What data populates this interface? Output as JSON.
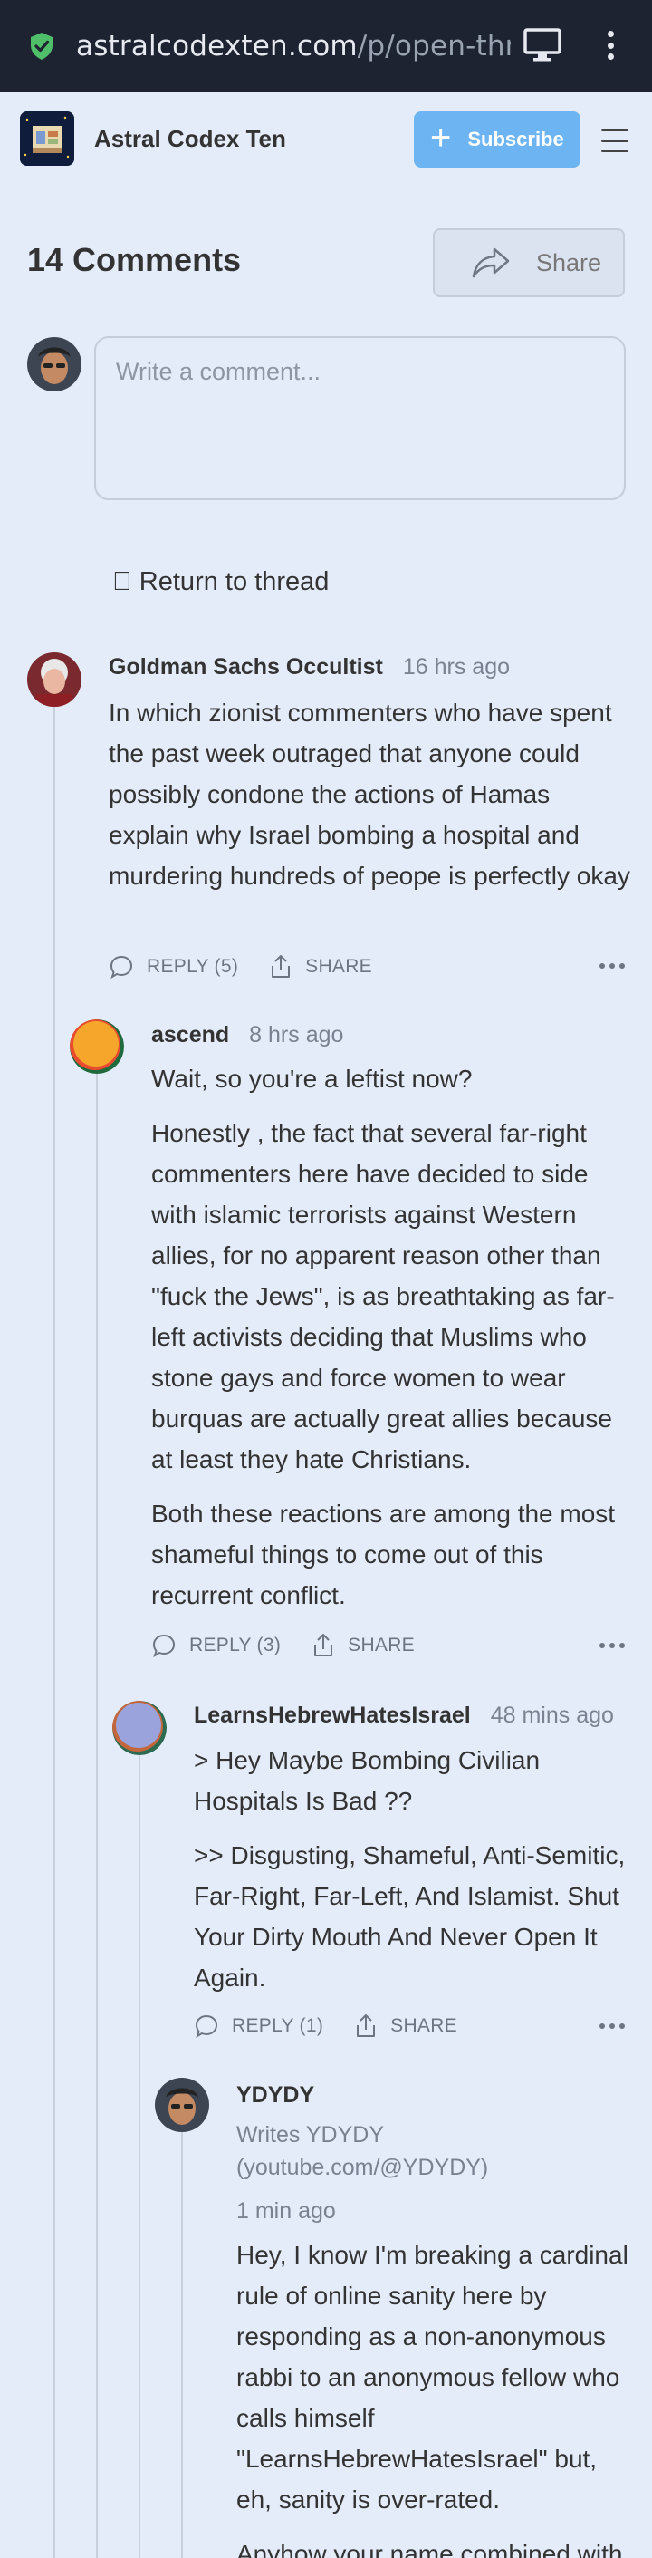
{
  "browser": {
    "url_main": "astralcodexten.com",
    "url_path": "/p/open-threa"
  },
  "site": {
    "name": "Astral Codex Ten",
    "subscribe_label": "Subscribe"
  },
  "header": {
    "comments_title": "14 Comments",
    "share_label": "Share"
  },
  "composer": {
    "placeholder": "Write a comment..."
  },
  "return_label": "\u0000 Return to thread",
  "comments": [
    {
      "name": "Goldman Sachs Occultist",
      "time": "16 hrs ago",
      "paragraphs": [
        "In which zionist commenters who have spent the past week outraged that anyone could possibly condone the actions of Hamas explain why Israel bombing a hospital and murdering hundreds of peope is perfectly okay"
      ],
      "reply_label": "REPLY (5)",
      "share_label": "SHARE"
    },
    {
      "name": "ascend",
      "time": "8 hrs ago",
      "paragraphs": [
        "Wait, so you're a leftist now?",
        "Honestly , the fact that several far-right commenters here have decided to side with islamic terrorists against Western allies, for no apparent reason other than \"fuck the Jews\", is as breathtaking as far-left activists deciding that Muslims who stone gays and force women to wear burquas are actually great allies because at least they hate Christians.",
        "Both these reactions are among the most shameful things to come out of this recurrent conflict."
      ],
      "reply_label": "REPLY (3)",
      "share_label": "SHARE"
    },
    {
      "name": "LearnsHebrewHatesIsrael",
      "time": "48 mins ago",
      "paragraphs": [
        "> Hey Maybe Bombing Civilian Hospitals Is Bad ??",
        ">> Disgusting, Shameful, Anti-Semitic, Far-Right, Far-Left, And Islamist. Shut Your Dirty Mouth And Never Open It Again."
      ],
      "reply_label": "REPLY (1)",
      "share_label": "SHARE"
    },
    {
      "name": "YDYDY",
      "byline": "Writes YDYDY (youtube.com/@YDYDY)",
      "time": "1 min ago",
      "paragraphs": [
        "Hey, I know I'm breaking a cardinal rule of online sanity here by responding as a non-anonymous rabbi to an anonymous fellow who calls himself \"LearnsHebrewHatesIsrael\" but, eh, sanity is over-rated.",
        "Anyhow your name combined with"
      ]
    }
  ],
  "colors": {
    "background": "#e4ecf9",
    "subscribe": "#6db4f3",
    "urlbar": "#1d2331"
  }
}
